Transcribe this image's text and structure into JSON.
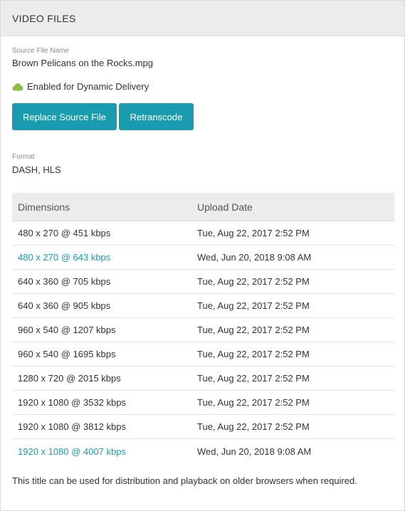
{
  "panel": {
    "title": "VIDEO FILES"
  },
  "source": {
    "label": "Source File Name",
    "value": "Brown Pelicans on the Rocks.mpg"
  },
  "delivery": {
    "icon": "cloud-icon",
    "icon_color": "#8bbf3f",
    "text": "Enabled for Dynamic Delivery"
  },
  "buttons": {
    "replace_label": "Replace Source File",
    "retranscode_label": "Retranscode",
    "color": "#1a9cb0"
  },
  "format": {
    "label": "Format",
    "value": "DASH, HLS"
  },
  "table": {
    "headers": [
      "Dimensions",
      "Upload Date"
    ],
    "rows": [
      {
        "dimensions": "480 x 270 @ 451 kbps",
        "date": "Tue, Aug 22, 2017 2:52 PM",
        "link": false
      },
      {
        "dimensions": "480 x 270 @ 643 kbps",
        "date": "Wed, Jun 20, 2018 9:08 AM",
        "link": true
      },
      {
        "dimensions": "640 x 360 @ 705 kbps",
        "date": "Tue, Aug 22, 2017 2:52 PM",
        "link": false
      },
      {
        "dimensions": "640 x 360 @ 905 kbps",
        "date": "Tue, Aug 22, 2017 2:52 PM",
        "link": false
      },
      {
        "dimensions": "960 x 540 @ 1207 kbps",
        "date": "Tue, Aug 22, 2017 2:52 PM",
        "link": false
      },
      {
        "dimensions": "960 x 540 @ 1695 kbps",
        "date": "Tue, Aug 22, 2017 2:52 PM",
        "link": false
      },
      {
        "dimensions": "1280 x 720 @ 2015 kbps",
        "date": "Tue, Aug 22, 2017 2:52 PM",
        "link": false
      },
      {
        "dimensions": "1920 x 1080 @ 3532 kbps",
        "date": "Tue, Aug 22, 2017 2:52 PM",
        "link": false
      },
      {
        "dimensions": "1920 x 1080 @ 3812 kbps",
        "date": "Tue, Aug 22, 2017 2:52 PM",
        "link": false
      },
      {
        "dimensions": "1920 x 1080 @ 4007 kbps",
        "date": "Wed, Jun 20, 2018 9:08 AM",
        "link": true
      }
    ]
  },
  "footnote": "This title can be used for distribution and playback on older browsers when required."
}
